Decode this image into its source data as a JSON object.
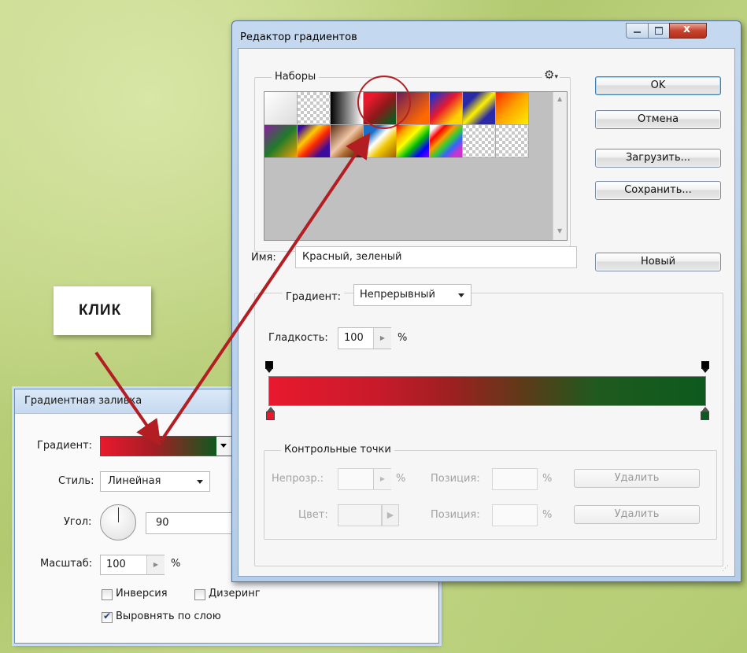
{
  "callout": {
    "text": "КЛИК"
  },
  "fill_dialog": {
    "title": "Градиентная заливка",
    "gradient_label": "Градиент:",
    "style_label": "Стиль:",
    "style_value": "Линейная",
    "angle_label": "Угол:",
    "angle_value": "90",
    "scale_label": "Масштаб:",
    "scale_value": "100",
    "scale_unit": "%",
    "reverse_label": "Инверсия",
    "reverse_checked": false,
    "dither_label": "Дизеринг",
    "dither_checked": false,
    "align_label": "Выровнять по слою",
    "align_checked": true
  },
  "editor": {
    "title": "Редактор градиентов",
    "presets_label": "Наборы",
    "buttons": {
      "ok": "OK",
      "cancel": "Отмена",
      "load": "Загрузить...",
      "save": "Сохранить...",
      "new": "Новый"
    },
    "name_label": "Имя:",
    "name_value": "Красный, зеленый",
    "gradient_type_label": "Градиент:",
    "gradient_type_value": "Непрерывный",
    "smoothness_label": "Гладкость:",
    "smoothness_value": "100",
    "smoothness_unit": "%",
    "stops_group_label": "Контрольные точки",
    "opacity_label": "Непрозр.:",
    "opacity_unit": "%",
    "position_label_1": "Позиция:",
    "position_unit_1": "%",
    "delete_1": "Удалить",
    "color_label": "Цвет:",
    "position_label_2": "Позиция:",
    "position_unit_2": "%",
    "delete_2": "Удалить",
    "gradient_colors": {
      "start": "#e8192e",
      "end": "#0d5a1e"
    }
  }
}
